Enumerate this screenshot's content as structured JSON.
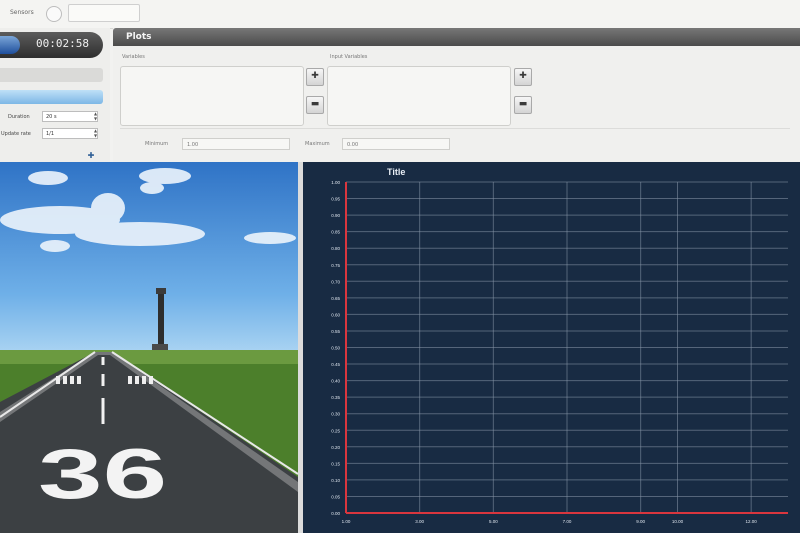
{
  "toolbar": {
    "sensors_label": "Sensors",
    "sensor_value": ""
  },
  "sim": {
    "timer": "00:02:58",
    "duration_label": "Duration",
    "duration_value": "20 s",
    "update_rate_label": "Update rate",
    "update_rate_value": "1/1",
    "add_icon": "add-icon"
  },
  "plots": {
    "header": "Plots",
    "variables_label": "Variables",
    "input_variables_label": "Input Variables",
    "minimum_label": "Minimum",
    "minimum_value": "1.00",
    "maximum_label": "Maximum",
    "maximum_value": "0.00"
  },
  "scene": {
    "runway_number": "36"
  },
  "chart_data": {
    "type": "line",
    "title": "Title",
    "xlabel": "",
    "ylabel": "",
    "xlim": [
      1.0,
      13.0
    ],
    "ylim": [
      0.0,
      1.0
    ],
    "x_ticks": [
      "1.00",
      "3.00",
      "5.00",
      "7.00",
      "9.00",
      "10.00",
      "12.00"
    ],
    "y_ticks": [
      "0.00",
      "0.05",
      "0.10",
      "0.15",
      "0.20",
      "0.25",
      "0.30",
      "0.35",
      "0.40",
      "0.45",
      "0.50",
      "0.55",
      "0.60",
      "0.65",
      "0.70",
      "0.75",
      "0.80",
      "0.85",
      "0.90",
      "0.95",
      "1.00"
    ],
    "grid": true,
    "series": [
      {
        "values": [
          [
            1.0,
            0.0
          ],
          [
            13.0,
            0.0
          ]
        ],
        "color": "#d9363e"
      },
      {
        "values": [
          [
            1.0,
            0.0
          ],
          [
            1.0,
            1.0
          ]
        ],
        "color": "#d9363e"
      }
    ],
    "colors": {
      "background": "#182b43",
      "grid": "#8796a8",
      "axis_text": "#dfe6ef"
    }
  }
}
